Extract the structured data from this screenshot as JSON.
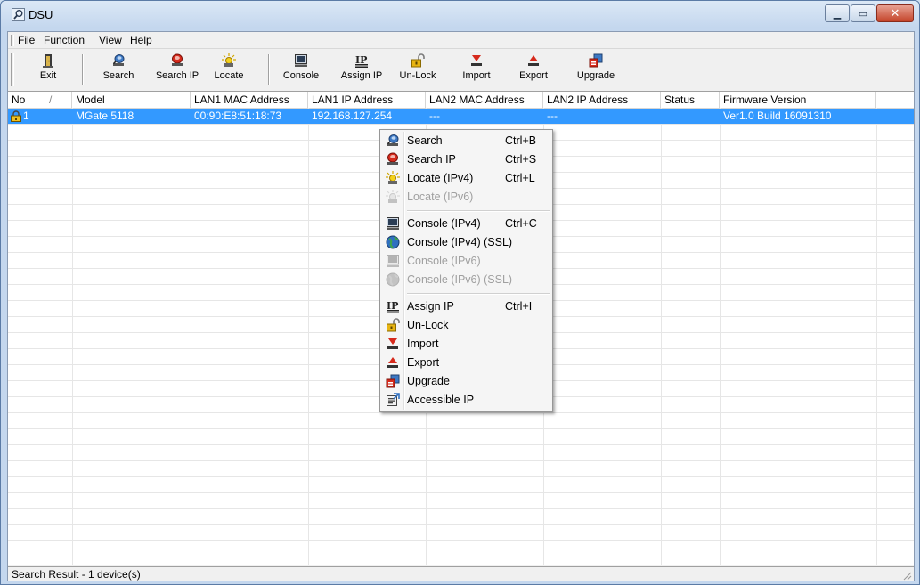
{
  "window": {
    "title": "DSU"
  },
  "menu": [
    "File",
    "Function",
    "View",
    "Help"
  ],
  "toolbar": [
    "Exit",
    "Search",
    "Search IP",
    "Locate",
    "Console",
    "Assign IP",
    "Un-Lock",
    "Import",
    "Export",
    "Upgrade"
  ],
  "table": {
    "headers": [
      "No",
      "Model",
      "LAN1 MAC Address",
      "LAN1 IP Address",
      "LAN2 MAC Address",
      "LAN2 IP Address",
      "Status",
      "Firmware Version"
    ],
    "sort_indicator": "/",
    "rows": [
      {
        "no": "1",
        "model": "MGate 5118",
        "lan1_mac": "00:90:E8:51:18:73",
        "lan1_ip": "192.168.127.254",
        "lan2_mac": "---",
        "lan2_ip": "---",
        "status": "",
        "firmware": "Ver1.0 Build 16091310"
      }
    ]
  },
  "context_menu": {
    "items": [
      {
        "label": "Search",
        "shortcut": "Ctrl+B",
        "enabled": true,
        "icon": "search-icon"
      },
      {
        "label": "Search IP",
        "shortcut": "Ctrl+S",
        "enabled": true,
        "icon": "search-ip-icon"
      },
      {
        "label": "Locate (IPv4)",
        "shortcut": "Ctrl+L",
        "enabled": true,
        "icon": "locate-icon"
      },
      {
        "label": "Locate (IPv6)",
        "shortcut": "",
        "enabled": false,
        "icon": "locate-icon"
      },
      {
        "label": "Console (IPv4)",
        "shortcut": "Ctrl+C",
        "enabled": true,
        "icon": "console-icon"
      },
      {
        "label": "Console (IPv4) (SSL)",
        "shortcut": "",
        "enabled": true,
        "icon": "globe-icon"
      },
      {
        "label": "Console (IPv6)",
        "shortcut": "",
        "enabled": false,
        "icon": "console-icon"
      },
      {
        "label": "Console (IPv6) (SSL)",
        "shortcut": "",
        "enabled": false,
        "icon": "globe-icon"
      },
      {
        "label": "Assign IP",
        "shortcut": "Ctrl+I",
        "enabled": true,
        "icon": "assign-ip-icon"
      },
      {
        "label": "Un-Lock",
        "shortcut": "",
        "enabled": true,
        "icon": "unlock-icon"
      },
      {
        "label": "Import",
        "shortcut": "",
        "enabled": true,
        "icon": "import-icon"
      },
      {
        "label": "Export",
        "shortcut": "",
        "enabled": true,
        "icon": "export-icon"
      },
      {
        "label": "Upgrade",
        "shortcut": "",
        "enabled": true,
        "icon": "upgrade-icon"
      },
      {
        "label": "Accessible IP",
        "shortcut": "",
        "enabled": true,
        "icon": "accessible-ip-icon"
      }
    ]
  },
  "status": {
    "text": "Search Result - 1 device(s)"
  },
  "colors": {
    "selection": "#3399ff",
    "title_gradient": "#c4d7ee",
    "close_button": "#c4442a"
  }
}
